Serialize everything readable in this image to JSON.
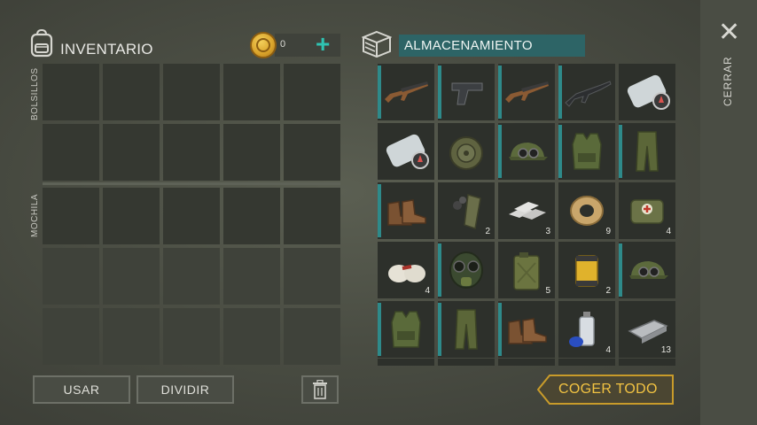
{
  "inventory": {
    "title": "INVENTARIO",
    "coins": "0",
    "add_symbol": "+",
    "pockets_label": "BOLSILLOS",
    "backpack_label": "MOCHILA",
    "use_button": "USAR",
    "split_button": "DIVIDIR"
  },
  "storage": {
    "title": "ALMACENAMIENTO",
    "take_all_button": "COGER TODO",
    "items": [
      {
        "name": "rifle-ak",
        "qty": "",
        "marked": true
      },
      {
        "name": "pistol",
        "qty": "",
        "marked": true
      },
      {
        "name": "rifle-ak",
        "qty": "",
        "marked": true
      },
      {
        "name": "rifle-m16",
        "qty": "",
        "marked": true
      },
      {
        "name": "map",
        "qty": "",
        "marked": false
      },
      {
        "name": "map",
        "qty": "",
        "marked": false
      },
      {
        "name": "landmine",
        "qty": "",
        "marked": false
      },
      {
        "name": "camo-cap",
        "qty": "",
        "marked": true
      },
      {
        "name": "camo-vest",
        "qty": "",
        "marked": true
      },
      {
        "name": "camo-pants",
        "qty": "",
        "marked": true
      },
      {
        "name": "boots",
        "qty": "",
        "marked": true
      },
      {
        "name": "rifle-magazine",
        "qty": "2",
        "marked": false
      },
      {
        "name": "metal-ingots",
        "qty": "3",
        "marked": false
      },
      {
        "name": "wire-spool",
        "qty": "9",
        "marked": false
      },
      {
        "name": "medkit-bag",
        "qty": "4",
        "marked": false
      },
      {
        "name": "bandages",
        "qty": "4",
        "marked": false
      },
      {
        "name": "gas-mask",
        "qty": "",
        "marked": true
      },
      {
        "name": "jerry-can",
        "qty": "5",
        "marked": false
      },
      {
        "name": "oil-filter",
        "qty": "2",
        "marked": false
      },
      {
        "name": "camo-cap",
        "qty": "",
        "marked": true
      },
      {
        "name": "camo-vest",
        "qty": "",
        "marked": true
      },
      {
        "name": "camo-pants",
        "qty": "",
        "marked": true
      },
      {
        "name": "boots",
        "qty": "",
        "marked": true
      },
      {
        "name": "spray-can",
        "qty": "4",
        "marked": false
      },
      {
        "name": "metal-bar",
        "qty": "13",
        "marked": false
      }
    ]
  },
  "close": {
    "symbol": "✕",
    "label": "CERRAR"
  },
  "colors": {
    "accent": "#2fc3b2",
    "storage_header": "#2d6466",
    "take_all_text": "#f2c342",
    "slot_marker": "#2e8a8a"
  }
}
